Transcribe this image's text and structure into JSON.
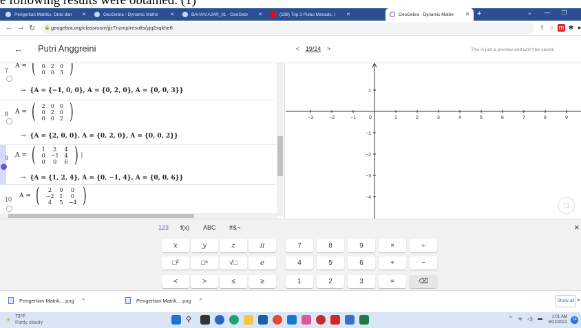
{
  "doc_text": "e following results were obtained. (1)",
  "browser": {
    "tabs": [
      {
        "label": "Pengertian Matriks, Ordo dan",
        "active": false,
        "color": "#c8d7f5"
      },
      {
        "label": "GeoGebra - Dynamic Mathe",
        "active": false,
        "color": "#c8d7f5"
      },
      {
        "label": "BAHAN AJAR_01 - GeoGebr",
        "active": false,
        "color": "#c8d7f5"
      },
      {
        "label": "(188) Trip 3 Pulau Manado, I",
        "active": false,
        "color": "#ff0000"
      },
      {
        "label": "GeoGebra - Dynamic Mathe",
        "active": true,
        "color": "#6557d2"
      }
    ],
    "new_tab": "+",
    "url": "geogebra.org/classroom/jjz7nzmp/results/yjq2xqkhe6"
  },
  "geogebra": {
    "back": "←",
    "user_name": "Putri Anggreini",
    "pager": "19/24",
    "pager_prev": "<",
    "pager_next": ">",
    "preview_note": "This is just a preview and won't be saved."
  },
  "algebra": [
    {
      "num": "7",
      "label": "A =",
      "matrix": [
        [
          "0",
          "2",
          "0"
        ],
        [
          "0",
          "0",
          "3"
        ]
      ],
      "result": "{A = {−1, 0, 0}, A = {0, 2, 0}, A = {0, 0, 3}}"
    },
    {
      "num": "8",
      "label": "A =",
      "matrix": [
        [
          "2",
          "0",
          "0"
        ],
        [
          "0",
          "2",
          "0"
        ],
        [
          "0",
          "0",
          "2"
        ]
      ],
      "result": "{A = {2, 0, 0}, A = {0, 2, 0}, A = {0, 0, 2}}"
    },
    {
      "num": "9",
      "label": "A =",
      "matrix": [
        [
          "1",
          "2",
          "4"
        ],
        [
          "0",
          "−1",
          "4"
        ],
        [
          "0",
          "0",
          "6"
        ]
      ],
      "result": "{A = {1, 2, 4}, A = {0, −1, 4}, A = {0, 0, 6}}"
    },
    {
      "num": "10",
      "label": "A =",
      "matrix": [
        [
          "2",
          "0",
          "0"
        ],
        [
          "−2",
          "1",
          "0"
        ],
        [
          "4",
          "5",
          "−4"
        ]
      ],
      "result": ""
    }
  ],
  "graphics": {
    "x_ticks": [
      "−3",
      "−2",
      "−1",
      "0",
      "1",
      "2",
      "3",
      "4",
      "5",
      "6",
      "7",
      "8",
      "9"
    ],
    "y_ticks_pos": [
      "1"
    ],
    "y_ticks_neg": [
      "−1",
      "−2",
      "−3",
      "−4"
    ]
  },
  "keyboard": {
    "tabs": [
      "123",
      "f(x)",
      "ABC",
      "#&¬"
    ],
    "close": "×",
    "keys_left": [
      [
        "x",
        "y",
        "z",
        "π"
      ],
      [
        "□²",
        "□ⁿ",
        "√□",
        "e"
      ],
      [
        "<",
        ">",
        "≤",
        "≥"
      ]
    ],
    "keys_right": [
      [
        "7",
        "8",
        "9",
        "×",
        "÷"
      ],
      [
        "4",
        "5",
        "6",
        "+",
        "−"
      ],
      [
        "1",
        "2",
        "3",
        "=",
        "⌫"
      ]
    ]
  },
  "downloads": {
    "items": [
      "Pengertian Matrik....png",
      "Pengertian Matrik....png"
    ],
    "show_all": "Show all",
    "close": "×"
  },
  "taskbar": {
    "weather_temp": "73°F",
    "weather_desc": "Partly cloudy",
    "time": "1:01 AM",
    "date": "6/22/2022",
    "notifications": "14"
  }
}
